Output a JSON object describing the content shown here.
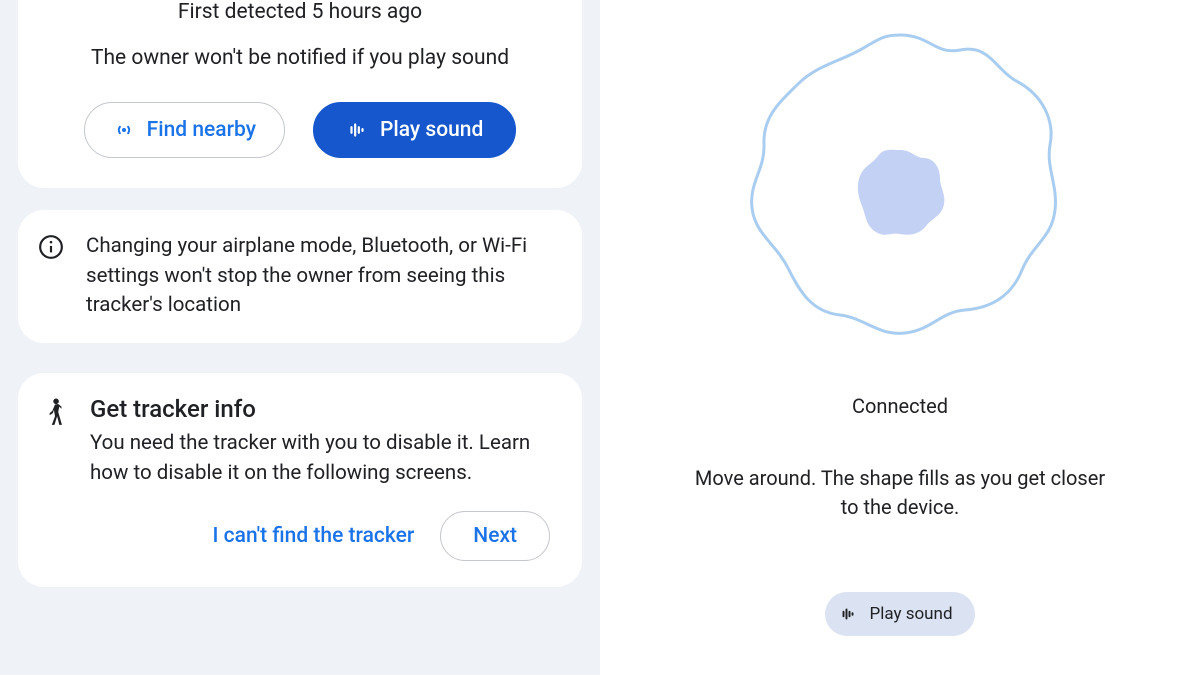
{
  "left": {
    "detected": "First detected 5 hours ago",
    "owner_note": "The owner won't be notified if you play sound",
    "find_nearby": "Find nearby",
    "play_sound": "Play sound",
    "info_text": "Changing your airplane mode, Bluetooth, or Wi-Fi settings won't stop the owner from seeing this tracker's location",
    "tracker": {
      "title": "Get tracker info",
      "body": "You need the tracker with you to disable it. Learn how to disable it on the following screens.",
      "cant_find": "I can't find the tracker",
      "next": "Next"
    }
  },
  "right": {
    "status": "Connected",
    "instructions": "Move around. The shape fills as you get closer to the device.",
    "play_sound": "Play sound"
  },
  "colors": {
    "primary": "#1657cd",
    "link": "#1a73e8",
    "radar_stroke": "#a9cdf0",
    "radar_fill": "#c3d2f4",
    "chip_bg": "#dbe3f3"
  }
}
